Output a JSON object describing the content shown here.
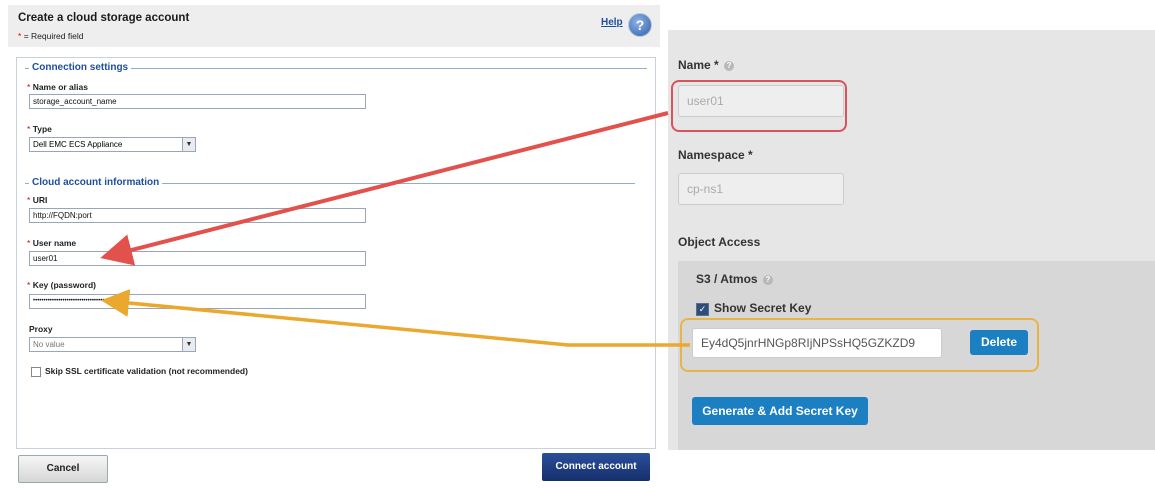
{
  "dialog": {
    "title": "Create a cloud storage account",
    "required_note": "= Required field",
    "required_mark": "*",
    "help_label": "Help",
    "connection_legend": "Connection settings",
    "cloud_legend": "Cloud account information",
    "fields": {
      "name_label": "Name or alias",
      "name_value": "storage_account_name",
      "type_label": "Type",
      "type_value": "Dell EMC ECS Appliance",
      "uri_label": "URI",
      "uri_value": "http://FQDN:port",
      "user_label": "User name",
      "user_value": "user01",
      "key_label": "Key (password)",
      "key_value": "••••••••••••••••••••••••••••••••••••••••••••••",
      "proxy_label": "Proxy",
      "proxy_value": "No value",
      "skip_ssl_label": "Skip SSL certificate validation (not recommended)"
    },
    "cancel_label": "Cancel",
    "connect_label": "Connect account"
  },
  "panel": {
    "name_label": "Name *",
    "name_value": "user01",
    "namespace_label": "Namespace *",
    "namespace_value": "cp-ns1",
    "object_access_label": "Object Access",
    "s3_label": "S3 / Atmos",
    "show_secret_label": "Show Secret Key",
    "secret_value": "Ey4dQ5jnrHNGp8RIjNPSsHQ5GZKZD9",
    "delete_label": "Delete",
    "generate_label": "Generate & Add Secret Key"
  },
  "colors": {
    "red_callout": "#d9535d",
    "orange_callout": "#e9b446",
    "primary_button": "#1b7fc1",
    "connect_button": "#1d3f82"
  },
  "icons": [
    "help-icon",
    "question-circle-icon",
    "dropdown-arrow-icon",
    "checkbox-checked-icon"
  ]
}
